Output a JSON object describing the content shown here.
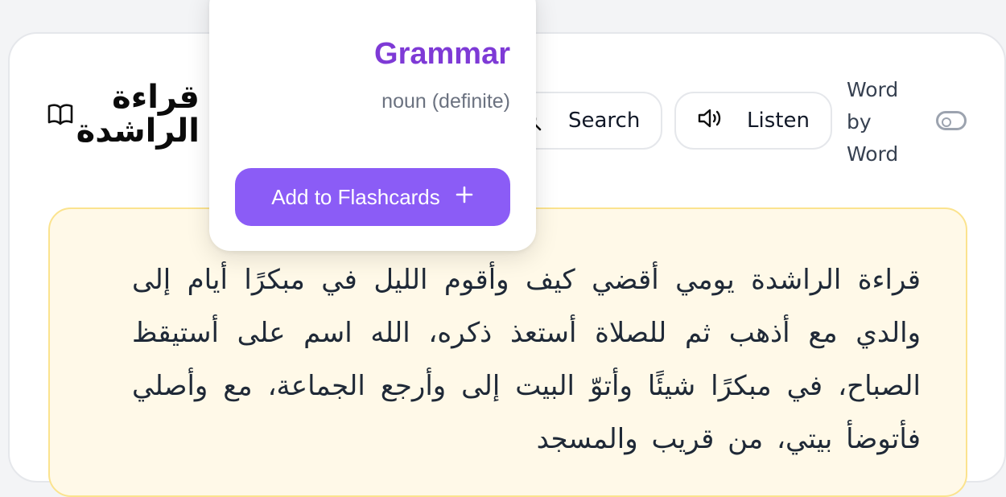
{
  "header": {
    "title": "قراءة الراشدة",
    "search_label": "Search",
    "listen_label": "Listen",
    "word_by_word_label": "Word by Word",
    "word_by_word_enabled": false
  },
  "reading": {
    "text": "قراءة الراشدة يومي أقضي كيف وأقوم الليل في مبكرًا أيام إلى والدي مع أذهب ثم للصلاة أستعذ ذكره، الله اسم على أستيقظ الصباح، في مبكرًا شيئًا وأتوّ البيت إلى وأرجع الجماعة، مع وأصلي فأتوضأ بيتي، من قريب والمسجد"
  },
  "popup": {
    "word": "Grammar",
    "part_of_speech": "noun (definite)",
    "add_button_label": "Add to Flashcards"
  },
  "colors": {
    "accent": "#8b5cf6",
    "word_color": "#7e3ad6",
    "reading_bg": "#fff9e8",
    "reading_border": "#fbe38e"
  }
}
